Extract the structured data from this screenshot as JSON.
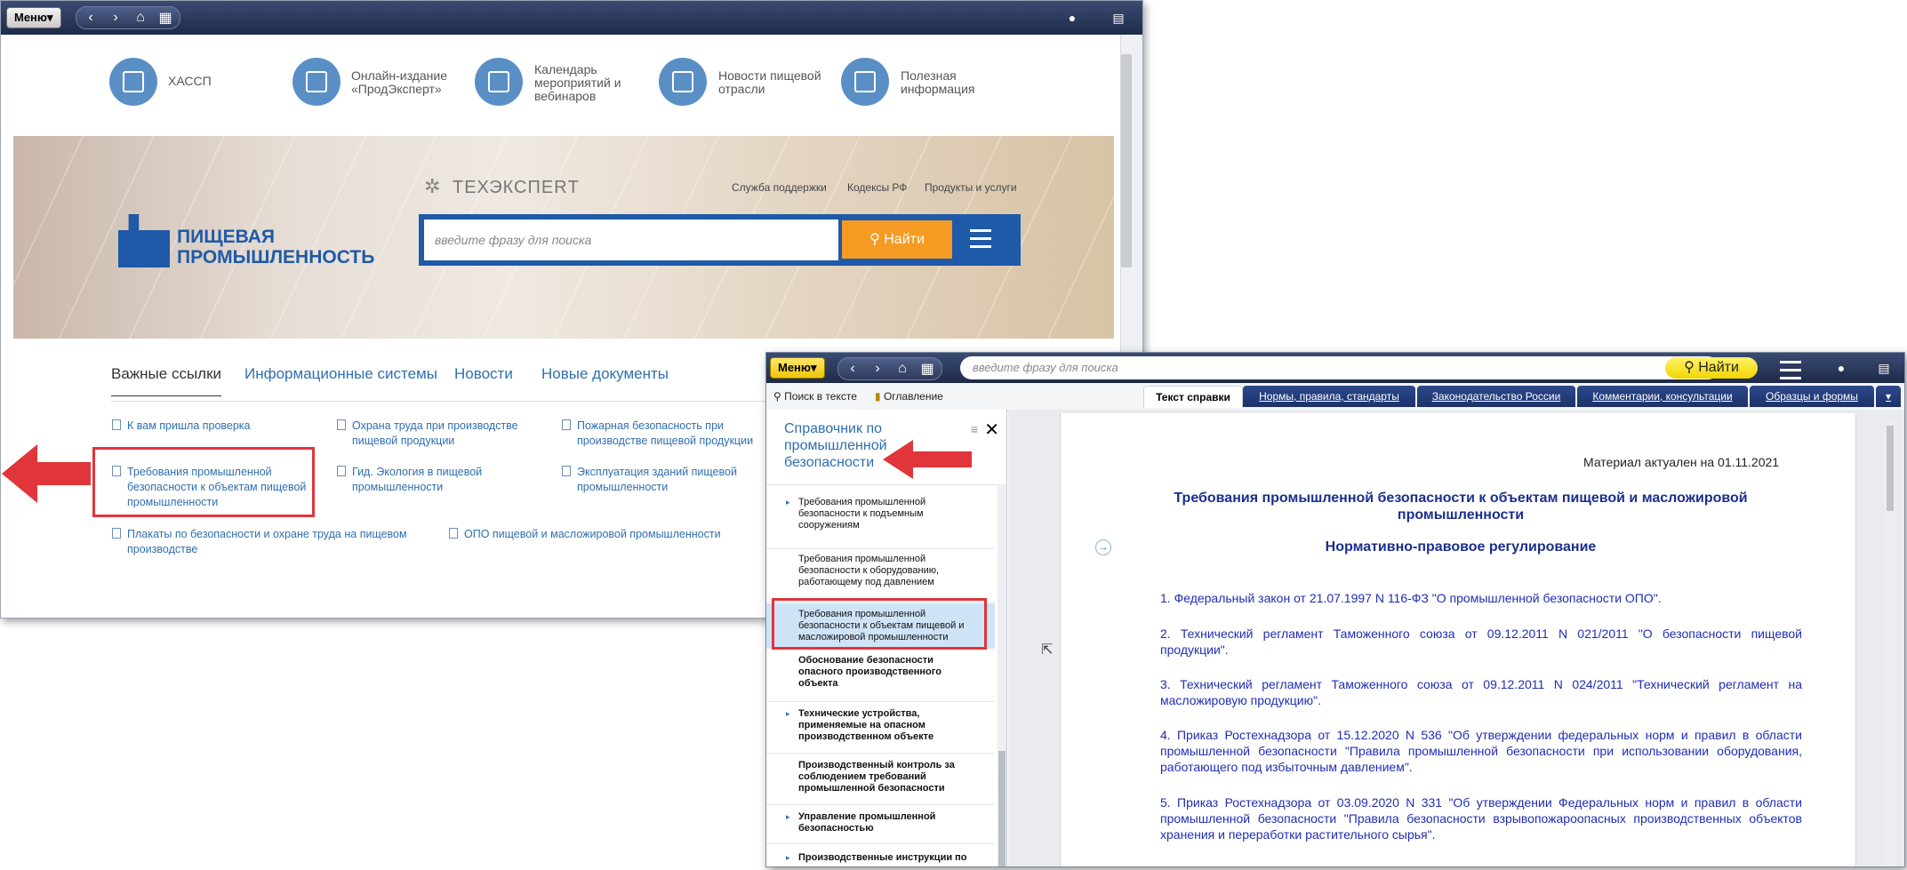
{
  "win1": {
    "menu_label": "Меню▾",
    "quick_links": [
      {
        "label": "ХАССП"
      },
      {
        "label": "Онлайн-издание «ПродЭксперт»"
      },
      {
        "label": "Календарь мероприятий и вебинаров"
      },
      {
        "label": "Новости пищевой отрасли"
      },
      {
        "label": "Полезная информация"
      }
    ],
    "banner": {
      "logo_line1": "ПИЩЕВАЯ",
      "logo_line2": "ПРОМЫШЛЕННОСТЬ",
      "tech_logo": "ТЕХЭКСПЕRТ",
      "links": [
        "Служба поддержки",
        "Кодексы РФ",
        "Продукты и услуги"
      ],
      "search_placeholder": "введите фразу для поиска",
      "search_button": "Найти"
    },
    "tabs": [
      "Важные ссылки",
      "Информационные системы",
      "Новости",
      "Новые документы"
    ],
    "links": [
      "К вам пришла проверка",
      "Охрана труда при производстве пищевой продукции",
      "Пожарная безопасность при производстве пищевой продукции",
      "Требования промышленной безопасности к объектам пищевой промышленности",
      "Гид. Экология в пищевой промышленности",
      "Эксплуатация зданий пищевой промышленности",
      "Плакаты по безопасности и охране труда на пищевом производстве",
      "ОПО пищевой и масложировой промышленности"
    ]
  },
  "win2": {
    "menu_label": "Меню▾",
    "search_placeholder": "введите фразу для поиска",
    "search_button": "Найти",
    "tools": [
      "Поиск в тексте",
      "Оглавление"
    ],
    "doc_tabs": [
      "Текст справки",
      "Нормы, правила, стандарты",
      "Законодательство России",
      "Комментарии, консультации",
      "Образцы и формы"
    ],
    "panel_title": "Справочник по промышленной безопасности",
    "tree": [
      "Требования промышленной безопасности к подъемным сооружениям",
      "Требования промышленной безопасности к оборудованию, работающему под давлением",
      "Требования промышленной безопасности к объектам пищевой и масложировой промышленности",
      "Обоснование безопасности опасного производственного объекта",
      "Технические устройства, применяемые на опасном производственном объекте",
      "Производственный контроль за соблюдением требований промышленной безопасности",
      "Управление промышленной безопасностью",
      "Производственные инструкции по"
    ],
    "doc": {
      "actual_date": "Материал актуален на 01.11.2021",
      "title": "Требования промышленной безопасности к объектам пищевой и масложировой промышленности",
      "subtitle": "Нормативно-правовое регулирование",
      "items": [
        "1. Федеральный закон от 21.07.1997 N 116-ФЗ \"О промышленной безопасности ОПО\".",
        "2. Технический регламент Таможенного союза от 09.12.2011 N 021/2011 \"О безопасности пищевой продукции\".",
        "3. Технический регламент Таможенного союза от 09.12.2011 N 024/2011 \"Технический регламент на масложировую продукцию\".",
        "4. Приказ Ростехнадзора от 15.12.2020 N 536 \"Об утверждении федеральных норм и правил в области промышленной безопасности \"Правила промышленной безопасности при использовании оборудования, работающего под избыточным давлением\".",
        "5. Приказ Ростехнадзора от 03.09.2020 N 331 \"Об утверждении Федеральных норм и правил в области промышленной безопасности \"Правила безопасности взрывопожароопасных производственных объектов хранения и переработки растительного сырья\"."
      ]
    }
  },
  "colors": {
    "accent_blue": "#1e5aa8",
    "highlight_red": "#e0353b",
    "search_orange": "#f59a23",
    "find_yellow": "#f2d500"
  }
}
